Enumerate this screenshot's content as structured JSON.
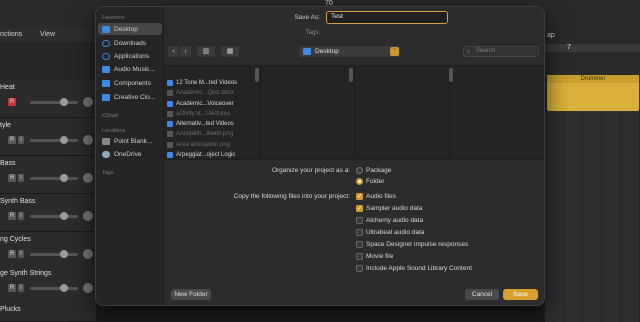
{
  "background": {
    "toolbar_labels": [
      "nctions",
      "View"
    ],
    "transport_digits": "70",
    "track_list": [
      {
        "name": "Heat"
      },
      {
        "name": "tyle"
      },
      {
        "name": "Bass"
      },
      {
        "name": "Synth Bass"
      },
      {
        "name": "ng Cycles"
      },
      {
        "name": "ge Synth Strings"
      },
      {
        "name": "Plucks"
      }
    ],
    "record_label": "R",
    "input_label": "I",
    "region_label": "Drummer",
    "ruler_mark": "7",
    "map_label": "ap"
  },
  "dialog": {
    "sidebar": {
      "favorites_header": "Favorites",
      "favorites": [
        {
          "label": "Desktop",
          "icon": "desktop-icon",
          "selected": true
        },
        {
          "label": "Downloads",
          "icon": "downloads-icon"
        },
        {
          "label": "Applications",
          "icon": "applications-icon"
        },
        {
          "label": "Audio Music...",
          "icon": "folder-icon"
        },
        {
          "label": "Components",
          "icon": "folder-icon"
        },
        {
          "label": "Creative Clo...",
          "icon": "folder-icon"
        }
      ],
      "icloud_header": "iCloud",
      "locations_header": "Locations",
      "locations": [
        {
          "label": "Point Blank...",
          "icon": "drive-icon"
        },
        {
          "label": "OneDrive",
          "icon": "cloud-icon"
        }
      ],
      "tags_header": "Tags"
    },
    "save_as_label": "Save As:",
    "save_as_value": "Test",
    "tags_label": "Tags:",
    "nav": {
      "back": "‹",
      "forward": "›",
      "view_columns": "▥",
      "view_grid": "▦"
    },
    "location": "Desktop",
    "search_placeholder": "Search",
    "files": [
      {
        "name": "12 Tone M...ted Videos",
        "type": "folder",
        "dim": false
      },
      {
        "name": "Academic...Quiz.docx",
        "type": "file",
        "dim": true
      },
      {
        "name": "Academic...Voiceover",
        "type": "folder",
        "dim": false
      },
      {
        "name": "activity st...t-lectures",
        "type": "file",
        "dim": true
      },
      {
        "name": "Alternativ...ted Videos",
        "type": "folder",
        "dim": false
      },
      {
        "name": "Annotatin...tteam.png",
        "type": "file",
        "dim": true
      },
      {
        "name": "Area annotation.png",
        "type": "file",
        "dim": true
      },
      {
        "name": "Arpeggiat...oject Logic",
        "type": "folder",
        "dim": false
      }
    ],
    "organize_label": "Organize your project as a:",
    "organize_options": [
      {
        "label": "Package",
        "selected": false
      },
      {
        "label": "Folder",
        "selected": true
      }
    ],
    "copy_label": "Copy the following files into your project:",
    "copy_options": [
      {
        "label": "Audio files",
        "checked": true
      },
      {
        "label": "Sampler audio data",
        "checked": true
      },
      {
        "label": "Alchemy audio data",
        "checked": false
      },
      {
        "label": "Ultrabeat audio data",
        "checked": false
      },
      {
        "label": "Space Designer impulse responses",
        "checked": false
      },
      {
        "label": "Movie file",
        "checked": false
      },
      {
        "label": "Include Apple Sound Library Content",
        "checked": false
      }
    ],
    "new_folder_label": "New Folder",
    "cancel_label": "Cancel",
    "save_label": "Save",
    "accent_color": "#d7a02c",
    "folder_color": "#3d8be4"
  }
}
